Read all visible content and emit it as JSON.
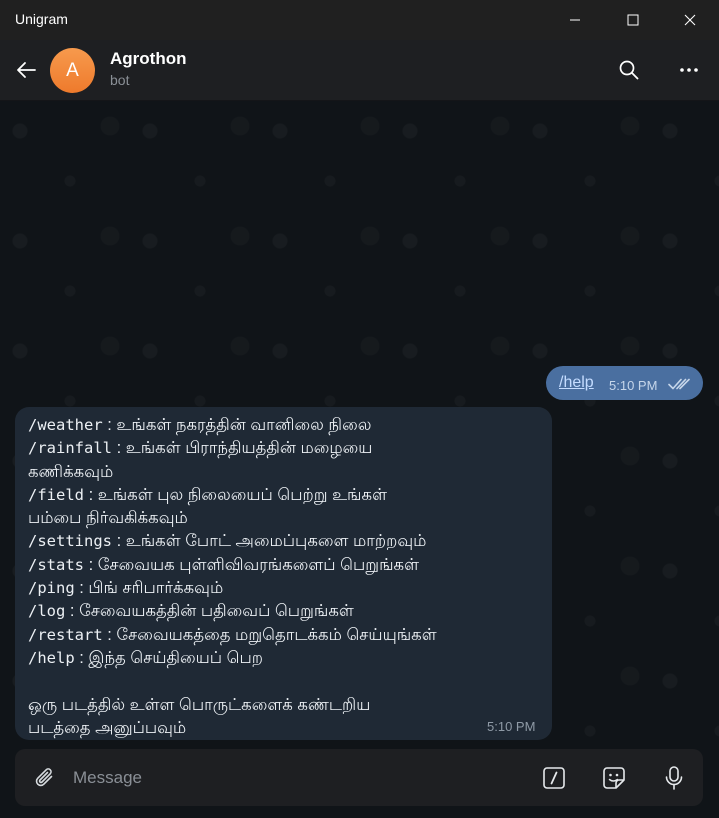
{
  "window": {
    "title": "Unigram"
  },
  "header": {
    "avatar_letter": "A",
    "name": "Agrothon",
    "status": "bot"
  },
  "outgoing": {
    "text": "/help",
    "time": "5:10 PM",
    "status": "read"
  },
  "incoming": {
    "lines": [
      {
        "cmd": "/weather",
        "text": " : உங்கள் நகரத்தின் வானிலை நிலை"
      },
      {
        "cmd": "/rainfall",
        "text": " : உங்கள் பிராந்தியத்தின் மழையை"
      },
      {
        "cmd": "",
        "text": "கணிக்கவும்"
      },
      {
        "cmd": "/field",
        "text": " : உங்கள் புல நிலையைப் பெற்று உங்கள்"
      },
      {
        "cmd": "",
        "text": "பம்பை நிர்வகிக்கவும்"
      },
      {
        "cmd": "/settings",
        "text": " : உங்கள் போட் அமைப்புகளை மாற்றவும்"
      },
      {
        "cmd": "/stats",
        "text": " : சேவையக புள்ளிவிவரங்களைப் பெறுங்கள்"
      },
      {
        "cmd": "/ping",
        "text": " : பிங் சரிபார்க்கவும்"
      },
      {
        "cmd": "/log",
        "text": " : சேவையகத்தின் பதிவைப் பெறுங்கள்"
      },
      {
        "cmd": "/restart",
        "text": " : சேவையகத்தை மறுதொடக்கம் செய்யுங்கள்"
      },
      {
        "cmd": "/help",
        "text": " : இந்த செய்தியைப் பெற"
      },
      {
        "cmd": "",
        "text": ""
      },
      {
        "cmd": "",
        "text": "ஒரு படத்தில் உள்ள பொருட்களைக் கண்டறிய"
      },
      {
        "cmd": "",
        "text": "படத்தை அனுப்பவும்"
      }
    ],
    "time": "5:10 PM"
  },
  "composer": {
    "placeholder": "Message"
  },
  "icons": {
    "minimize": "minimize-icon",
    "maximize": "maximize-icon",
    "close": "close-icon",
    "back": "back-arrow-icon",
    "search": "search-icon",
    "more": "more-icon",
    "attach": "paperclip-icon",
    "commands": "slash-command-icon",
    "sticker": "sticker-icon",
    "mic": "microphone-icon",
    "read": "double-check-icon"
  },
  "colors": {
    "accent_outgoing": "#4a6fa0",
    "incoming_bubble": "#1f2935",
    "avatar": "#f28a3a",
    "background": "#101418"
  }
}
